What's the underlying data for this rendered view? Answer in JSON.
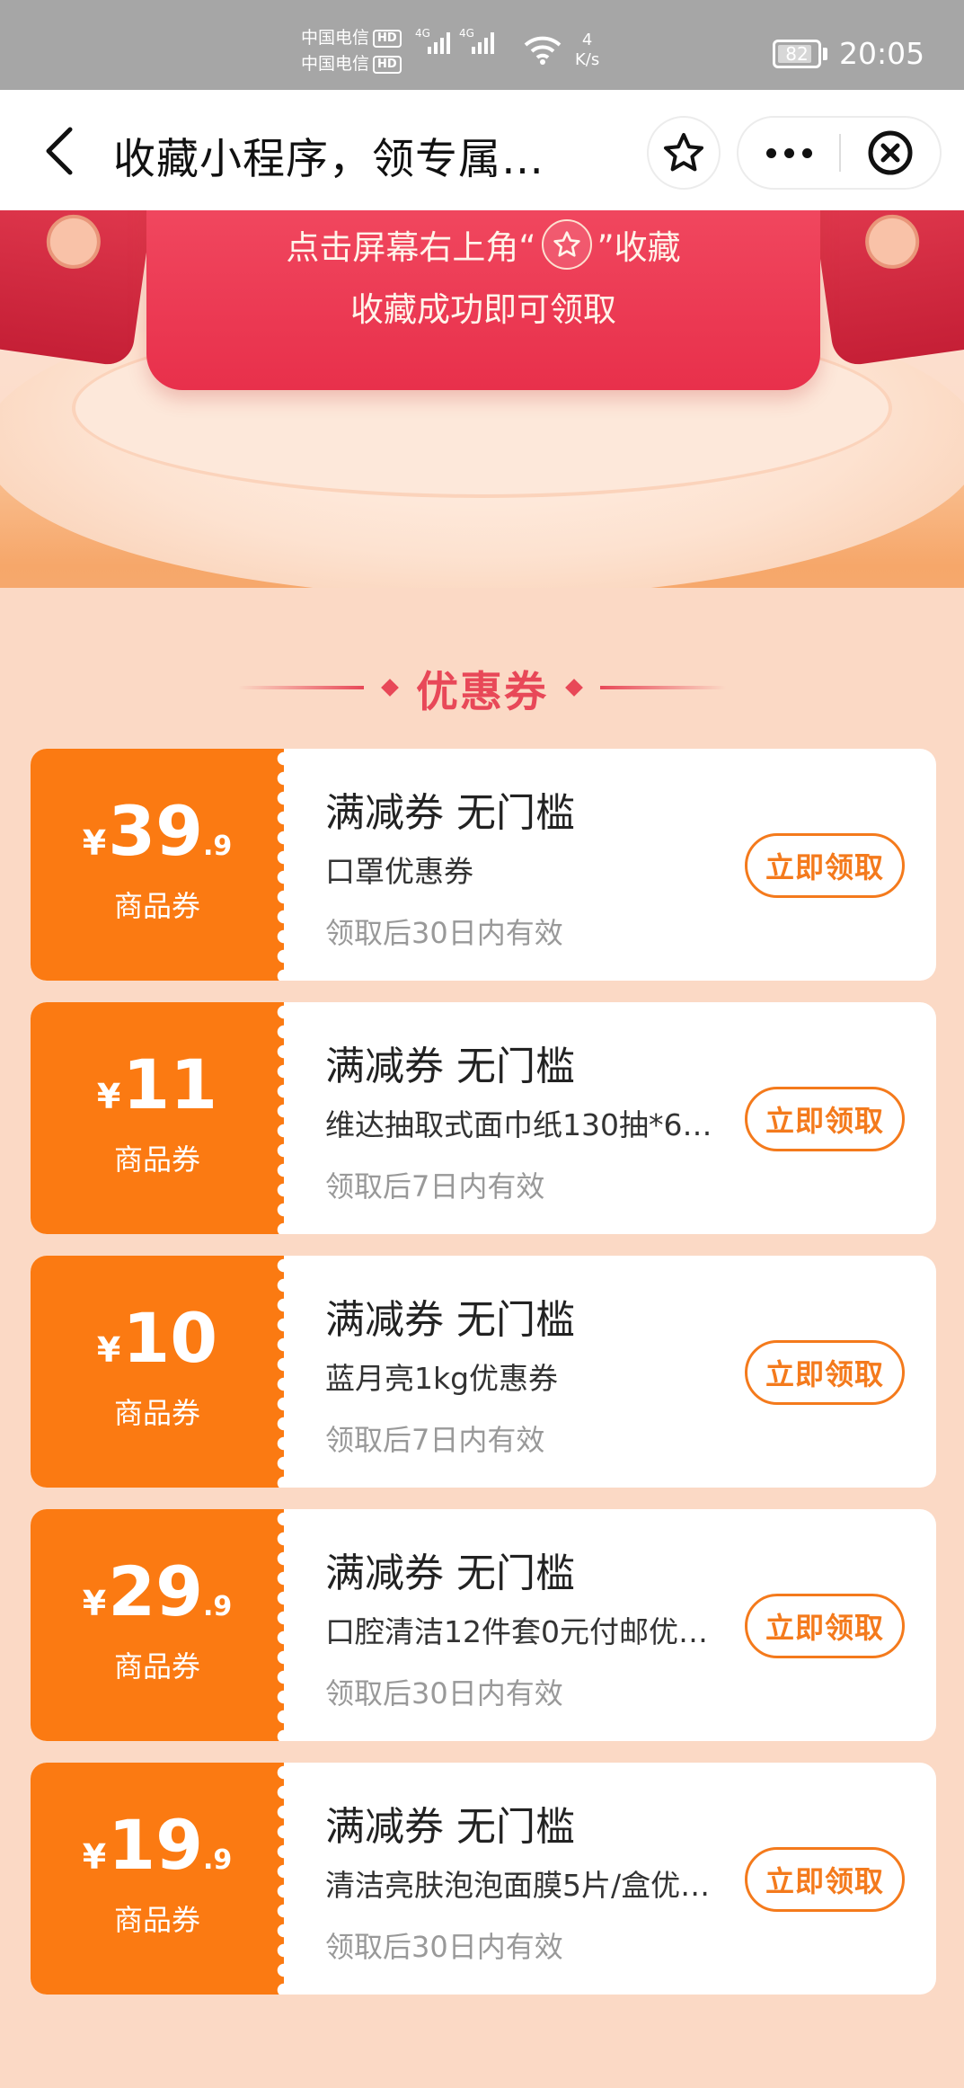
{
  "status_bar": {
    "carrier1": "中国电信",
    "carrier2": "中国电信",
    "hd": "HD",
    "net1": "4G",
    "net2": "4G",
    "speed_value": "4",
    "speed_unit": "K/s",
    "battery": "82",
    "time": "20:05"
  },
  "nav": {
    "title": "收藏小程序，领专属…",
    "icons": [
      "back-arrow-icon",
      "star-icon",
      "more-icon",
      "close-circle-icon"
    ]
  },
  "hero": {
    "line1_before": "点击屏幕右上角“",
    "line1_after": "”收藏",
    "line2": "收藏成功即可领取"
  },
  "section": {
    "title": "优惠券"
  },
  "coupons": [
    {
      "currency": "¥",
      "int": "39",
      "dec": ".9",
      "type": "商品券",
      "title": "满减券 无门槛",
      "desc": "口罩优惠券",
      "valid": "领取后30日内有效",
      "button": "立即领取"
    },
    {
      "currency": "¥",
      "int": "11",
      "dec": "",
      "type": "商品券",
      "title": "满减券 无门槛",
      "desc": "维达抽取式面巾纸130抽*6…",
      "valid": "领取后7日内有效",
      "button": "立即领取"
    },
    {
      "currency": "¥",
      "int": "10",
      "dec": "",
      "type": "商品券",
      "title": "满减券 无门槛",
      "desc": "蓝月亮1kg优惠券",
      "valid": "领取后7日内有效",
      "button": "立即领取"
    },
    {
      "currency": "¥",
      "int": "29",
      "dec": ".9",
      "type": "商品券",
      "title": "满减券 无门槛",
      "desc": "口腔清洁12件套0元付邮优…",
      "valid": "领取后30日内有效",
      "button": "立即领取"
    },
    {
      "currency": "¥",
      "int": "19",
      "dec": ".9",
      "type": "商品券",
      "title": "满减券 无门槛",
      "desc": "清洁亮肤泡泡面膜5片/盒优…",
      "valid": "领取后30日内有效",
      "button": "立即领取"
    }
  ],
  "colors": {
    "accent_orange": "#fb7a12",
    "button_orange": "#f47a1c",
    "title_red": "#e84858",
    "page_bg": "#fbd9c5"
  }
}
